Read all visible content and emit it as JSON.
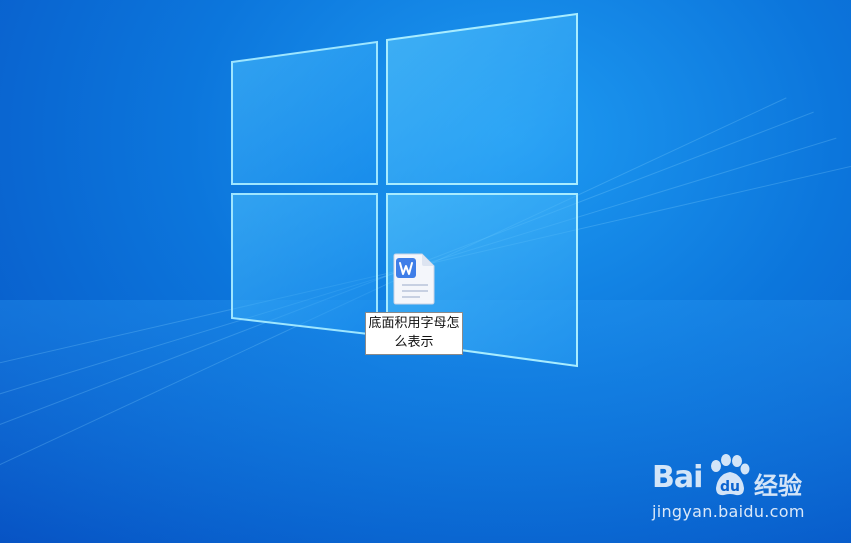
{
  "desktop": {
    "wallpaper": "windows-10-hero",
    "accent_color": "#0c76dc",
    "icons": [
      {
        "type": "word-document",
        "icon": "word-document-icon",
        "label": "底面积用字母怎么表示",
        "selected": true
      }
    ]
  },
  "watermark": {
    "brand": "Bai",
    "brand_suffix": "经验",
    "url": "jingyan.baidu.com"
  }
}
